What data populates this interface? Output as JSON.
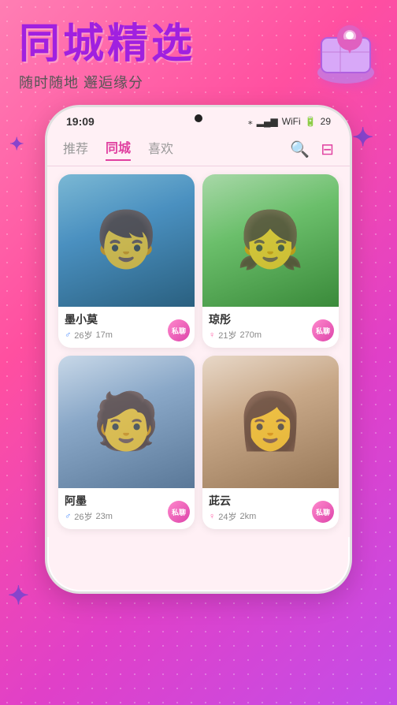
{
  "app": {
    "title": "同城精选",
    "subtitle": "随时随地 邂逅缘分"
  },
  "status_bar": {
    "time": "19:09",
    "bluetooth": "⁎",
    "signal": "▂▄▆",
    "wifi": "WiFi",
    "battery": "29"
  },
  "nav": {
    "tabs": [
      {
        "label": "推荐",
        "active": false
      },
      {
        "label": "同城",
        "active": true
      },
      {
        "label": "喜欢",
        "active": false
      }
    ],
    "search_label": "🔍",
    "filter_label": "⊟"
  },
  "profiles": [
    {
      "name": "墨小莫",
      "gender": "male",
      "age": "26岁",
      "distance": "17m",
      "chat": "私聊",
      "photo_type": "boy1",
      "emoji": "👦"
    },
    {
      "name": "琼彤",
      "gender": "female",
      "age": "21岁",
      "distance": "270m",
      "chat": "私聊",
      "photo_type": "girl1",
      "emoji": "👧"
    },
    {
      "name": "阿墨",
      "gender": "male",
      "age": "26岁",
      "distance": "23m",
      "chat": "私聊",
      "photo_type": "boy2",
      "emoji": "🧑"
    },
    {
      "name": "茈云",
      "gender": "female",
      "age": "24岁",
      "distance": "2km",
      "chat": "私聊",
      "photo_type": "girl2",
      "emoji": "👩"
    }
  ],
  "sparkles": {
    "top_right": "✦",
    "top_left": "✦",
    "bottom_left": "✦"
  }
}
